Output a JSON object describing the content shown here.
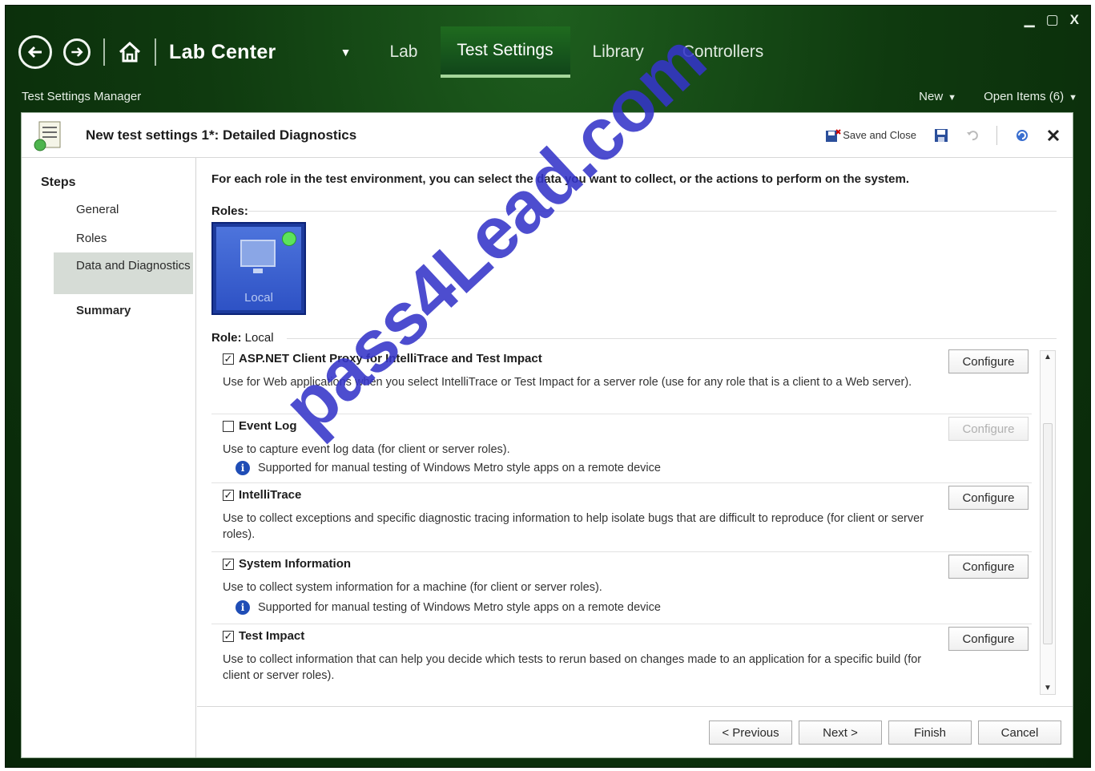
{
  "window": {
    "minimize": "▁",
    "maximize": "▢",
    "close": "X"
  },
  "nav": {
    "app_title": "Lab Center",
    "dropdown_caret": "▼",
    "tabs": [
      {
        "label": "Lab",
        "active": false
      },
      {
        "label": "Test Settings",
        "active": true
      },
      {
        "label": "Library",
        "active": false
      },
      {
        "label": "Controllers",
        "active": false
      }
    ]
  },
  "subbar": {
    "title": "Test Settings Manager",
    "new_label": "New",
    "open_items_label": "Open Items (6)"
  },
  "panel": {
    "title": "New test settings 1*: Detailed Diagnostics",
    "save_close_label": "Save and Close"
  },
  "steps": {
    "title": "Steps",
    "items": [
      "General",
      "Roles",
      "Data and Diagnostics",
      "Summary"
    ]
  },
  "main": {
    "intro": "For each role in the test environment, you can select the data you want to collect, or the actions to perform on the system.",
    "roles_label": "Roles:",
    "role_tile_name": "Local",
    "role_selected_label": "Role:",
    "role_selected_value": "Local"
  },
  "adapters": [
    {
      "name": "ASP.NET Client Proxy for IntelliTrace and Test Impact",
      "checked": true,
      "desc": "Use for Web applications when you select IntelliTrace or Test Impact for a server role (use for any role that is a client to a Web server).",
      "note": "",
      "button": "Configure",
      "button_enabled": true
    },
    {
      "name": "Event Log",
      "checked": false,
      "desc": "Use to capture event log data (for client or server roles).",
      "note": "Supported for manual testing of Windows Metro style apps on a remote device",
      "button": "Configure",
      "button_enabled": false
    },
    {
      "name": "IntelliTrace",
      "checked": true,
      "desc": "Use to collect exceptions and specific diagnostic tracing information to help isolate bugs that are difficult to reproduce (for client or server roles).",
      "note": "",
      "button": "Configure",
      "button_enabled": true
    },
    {
      "name": "System Information",
      "checked": true,
      "desc": "Use to collect system information for a machine (for client or server roles).",
      "note": "Supported for manual testing of Windows Metro style apps on a remote device",
      "button": "Configure",
      "button_enabled": true
    },
    {
      "name": "Test Impact",
      "checked": true,
      "desc": "Use to collect information that can help you decide which tests to rerun based on changes made to an application for a specific build (for client or server roles).",
      "note": "",
      "button": "Configure",
      "button_enabled": true
    }
  ],
  "footer": {
    "previous": "< Previous",
    "next": "Next >",
    "finish": "Finish",
    "cancel": "Cancel"
  },
  "watermark": "pass4Lead.com",
  "colors": {
    "frame": "#0f3a0f",
    "accent": "#a4d69a",
    "role_tile": "#2e52c5",
    "watermark": "#3434c8"
  }
}
